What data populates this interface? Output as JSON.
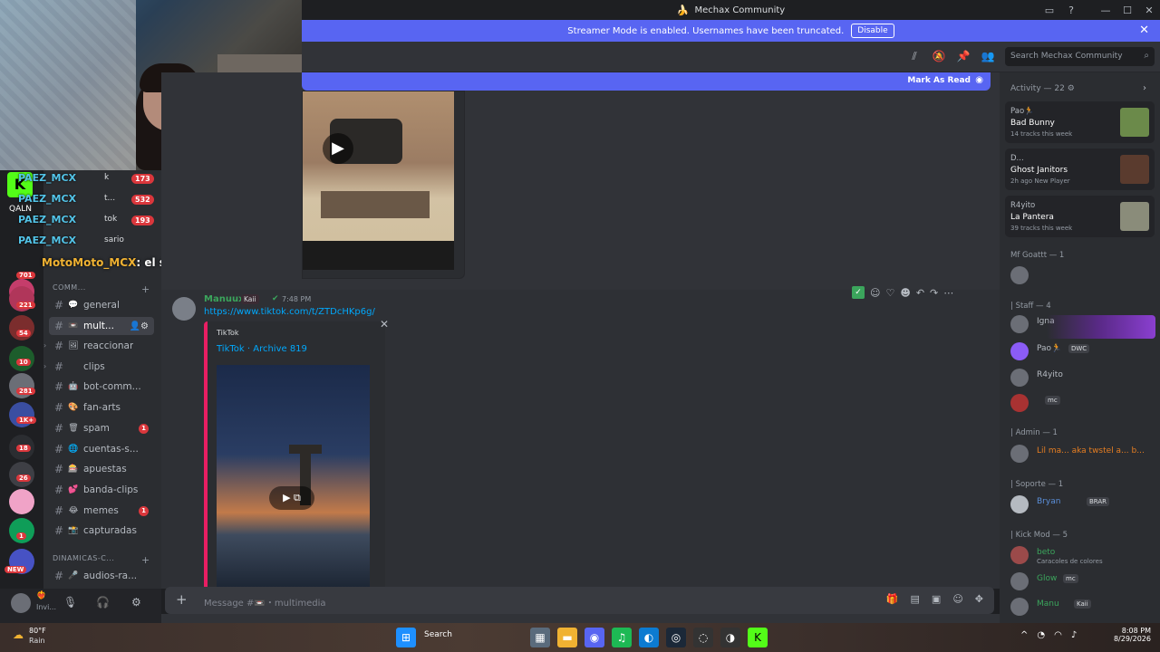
{
  "window": {
    "title": "Mechax Community",
    "controls": [
      "▭",
      "?",
      "—",
      "☐",
      "✕"
    ]
  },
  "streamer_banner": {
    "text": "Streamer Mode is enabled. Usernames have been truncated.",
    "button": "Disable"
  },
  "header": {
    "search_placeholder": "Search Mechax Community"
  },
  "overlay_chat": {
    "rows": [
      {
        "user": "PAEZ_MCX",
        "mid": "k",
        "badge": "173"
      },
      {
        "user": "PAEZ_MCX",
        "mid": "t...",
        "badge": "532"
      },
      {
        "user": "PAEZ_MCX",
        "mid": "tok",
        "badge": "193"
      },
      {
        "user": "PAEZ_MCX",
        "mid": "sario",
        "badge": ""
      }
    ],
    "message_user": "MotoMoto_MCX",
    "message_text": ": el son of dicipline",
    "logo_text": "QALN"
  },
  "server_badges": [
    "701",
    "221",
    "54",
    "10",
    "281",
    "1K+",
    "18",
    "26",
    "1",
    "NEW"
  ],
  "channels": {
    "category1": "COMM...",
    "items": [
      {
        "emoji": "💬",
        "label": "general",
        "badge": ""
      },
      {
        "emoji": "📼",
        "label": "mult...",
        "badge": "",
        "active": true
      },
      {
        "emoji": "🖼",
        "label": "reaccionar",
        "badge": ""
      },
      {
        "emoji": "",
        "label": "clips",
        "badge": ""
      },
      {
        "emoji": "🤖",
        "label": "bot-comm...",
        "badge": ""
      },
      {
        "emoji": "🎨",
        "label": "fan-arts",
        "badge": ""
      },
      {
        "emoji": "🗑",
        "label": "spam",
        "badge": "1"
      },
      {
        "emoji": "🌐",
        "label": "cuentas-s...",
        "badge": ""
      },
      {
        "emoji": "🎰",
        "label": "apuestas",
        "badge": ""
      },
      {
        "emoji": "💕",
        "label": "banda-clips",
        "badge": ""
      },
      {
        "emoji": "😂",
        "label": "memes",
        "badge": "1"
      },
      {
        "emoji": "📸",
        "label": "capturadas",
        "badge": ""
      }
    ],
    "category2": "DINAMICAS-C...",
    "extra": {
      "emoji": "🎤",
      "label": "audios-ra..."
    }
  },
  "user_panel": {
    "name": "❤️‍🔥",
    "status": "Invi..."
  },
  "main": {
    "mark_as_read": "Mark As Read",
    "message": {
      "author": "Manuux",
      "tag": "Kaii",
      "time": "7:48 PM",
      "link": "https://www.tiktok.com/t/ZTDcHKp6g/",
      "embed_provider": "TikTok",
      "embed_title": "TikTok · Archive 819"
    },
    "input_placeholder": "Message #📼・multimedia"
  },
  "activity": {
    "header": "Activity — 22",
    "cards": [
      {
        "who": "Pao🏃",
        "what": "Bad Bunny",
        "sub": "14 tracks this week"
      },
      {
        "who": "D...",
        "what": "Ghost Janitors",
        "sub": "2h ago  New Player"
      },
      {
        "who": "R4yito",
        "what": "La Pantera",
        "sub": "39 tracks this week"
      }
    ]
  },
  "members": {
    "sections": [
      {
        "title": "Mf Goattt — 1"
      },
      {
        "title": "| Staff — 4"
      },
      {
        "title": "| Admin — 1"
      },
      {
        "title": "| Soporte — 1"
      },
      {
        "title": "| Kick Mod — 5"
      }
    ],
    "staff": [
      {
        "name": "Igna",
        "badge": ""
      },
      {
        "name": "Pao🏃",
        "badge": "DWC"
      },
      {
        "name": "R4yito",
        "badge": ""
      },
      {
        "name": "",
        "badge": "mc"
      }
    ],
    "admin": [
      {
        "name": "Lil ma... aka twstel a... b..."
      }
    ],
    "soporte": [
      {
        "name": "Bryan",
        "badge": "BRAR"
      }
    ],
    "kick": [
      {
        "name": "beto",
        "sub": "Caracoles de colores"
      },
      {
        "name": "Glow",
        "badge": "mc"
      },
      {
        "name": "Manu",
        "badge": "Kaii"
      }
    ]
  },
  "taskbar": {
    "temp": "80°F",
    "cond": "Rain",
    "search": "Search",
    "time": "8:08 PM",
    "date": "8/29/2026"
  }
}
